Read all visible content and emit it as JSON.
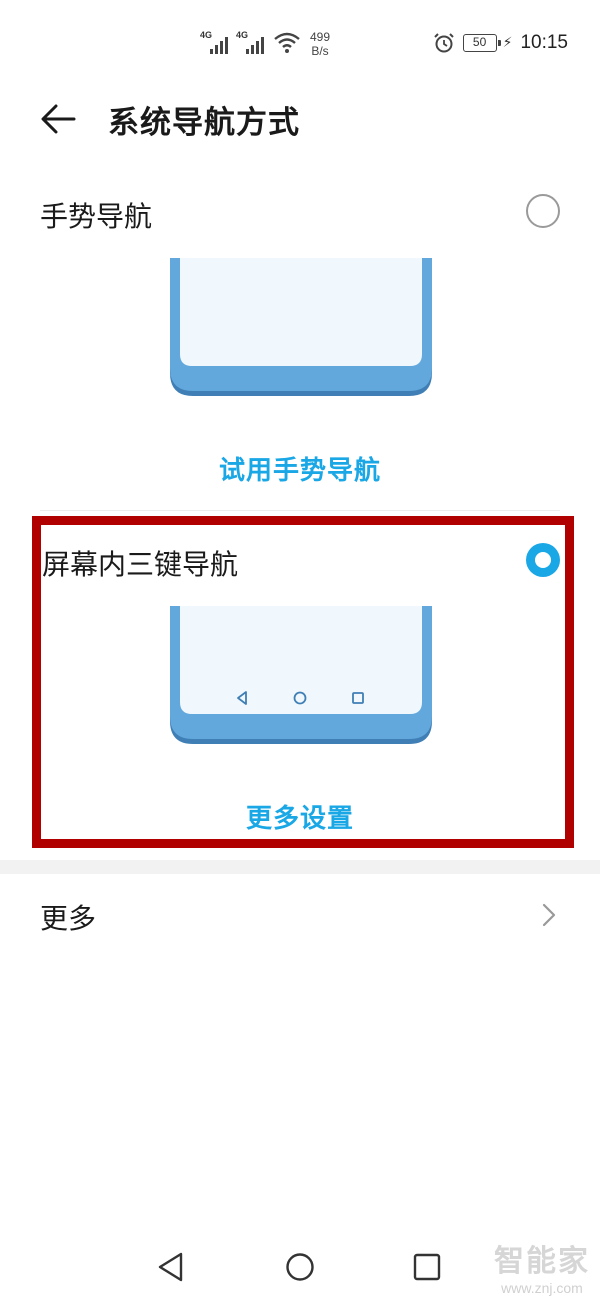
{
  "status_bar": {
    "signal1_tag": "4G",
    "signal2_tag": "4G",
    "net_speed_value": "499",
    "net_speed_unit": "B/s",
    "battery_level": "50",
    "time": "10:15"
  },
  "header": {
    "title": "系统导航方式"
  },
  "options": [
    {
      "label": "手势导航",
      "selected": false,
      "link": "试用手势导航"
    },
    {
      "label": "屏幕内三键导航",
      "selected": true,
      "link": "更多设置"
    }
  ],
  "more": {
    "label": "更多"
  },
  "watermark": {
    "brand": "智能家",
    "url": "www.znj.com"
  },
  "colors": {
    "accent": "#1aa7e6",
    "phone_body": "#62a8dc",
    "phone_screen": "#f1f8fd",
    "highlight_border": "#b00000"
  }
}
